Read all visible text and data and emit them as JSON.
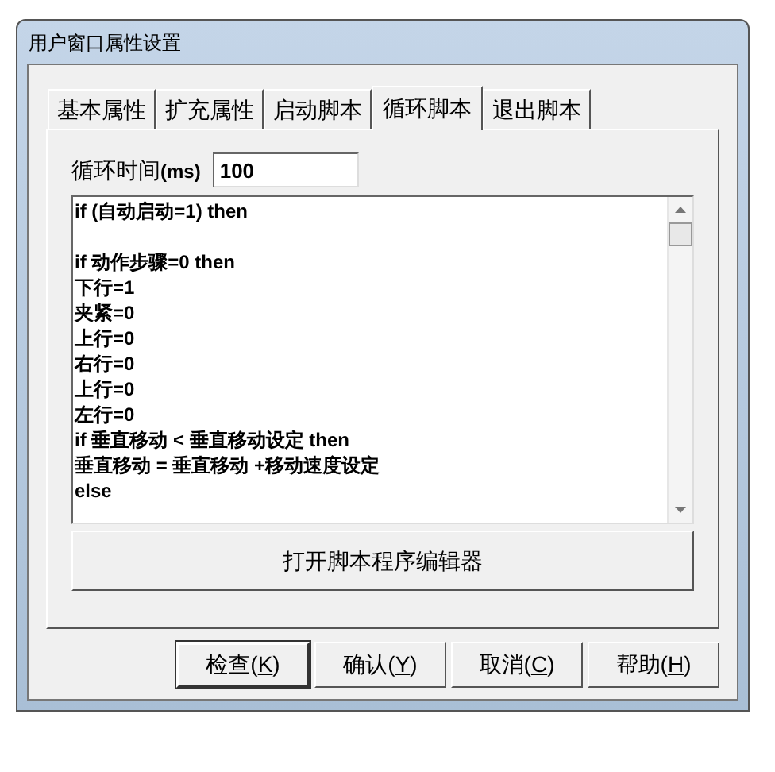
{
  "window": {
    "title": "用户窗口属性设置"
  },
  "tabs": [
    {
      "label": "基本属性",
      "selected": false
    },
    {
      "label": "扩充属性",
      "selected": false
    },
    {
      "label": "启动脚本",
      "selected": false
    },
    {
      "label": "循环脚本",
      "selected": true
    },
    {
      "label": "退出脚本",
      "selected": false
    }
  ],
  "cycle_time": {
    "label": "循环时间",
    "unit": "(ms)",
    "value": "100"
  },
  "script_lines": [
    {
      "kind": "code",
      "text": "if (自动启动=1) then"
    },
    {
      "kind": "blank"
    },
    {
      "kind": "code",
      "text": "if 动作步骤=0 then"
    },
    {
      "kind": "code",
      "text": "下行=1"
    },
    {
      "kind": "code",
      "text": "夹紧=0"
    },
    {
      "kind": "code",
      "text": "上行=0"
    },
    {
      "kind": "code",
      "text": "右行=0"
    },
    {
      "kind": "code",
      "text": "上行=0"
    },
    {
      "kind": "code",
      "text": "左行=0"
    },
    {
      "kind": "code",
      "text": "if 垂直移动 < 垂直移动设定 then"
    },
    {
      "kind": "code",
      "text": "垂直移动 = 垂直移动 +移动速度设定"
    },
    {
      "kind": "code",
      "text": "else"
    }
  ],
  "editor_button": "打开脚本程序编辑器",
  "buttons": [
    {
      "text": "检查(",
      "access_key": "K",
      "text_after": ")",
      "default": true
    },
    {
      "text": "确认(",
      "access_key": "Y",
      "text_after": ")",
      "default": false
    },
    {
      "text": "取消(",
      "access_key": "C",
      "text_after": ")",
      "default": false
    },
    {
      "text": "帮助(",
      "access_key": "H",
      "text_after": ")",
      "default": false
    }
  ]
}
